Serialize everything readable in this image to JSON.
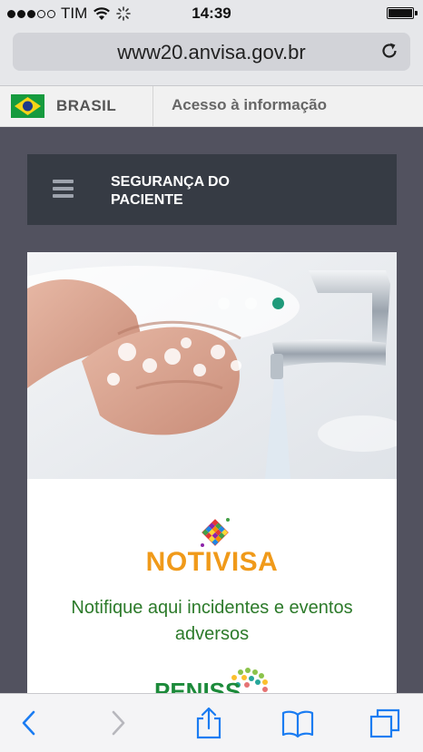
{
  "status": {
    "carrier": "TIM",
    "time": "14:39"
  },
  "browser": {
    "url": "www20.anvisa.gov.br"
  },
  "gov_bar": {
    "country": "BRASIL",
    "link": "Acesso à informação"
  },
  "site": {
    "title_line1": "SEGURANÇA DO",
    "title_line2": "PACIENTE",
    "carousel": {
      "slide_count": 3,
      "active_slide": 3
    },
    "notivisa": {
      "name": "NOTIVISA",
      "description": "Notifique aqui incidentes e eventos adversos"
    },
    "next_brand": "PENISS"
  },
  "colors": {
    "accent_green": "#1f9a7a",
    "notivisa_orange": "#f09a1a",
    "text_green": "#2c7a2a",
    "header_bg": "#363b44"
  },
  "icons": [
    "wifi-icon",
    "activity-spinner-icon",
    "battery-icon",
    "reload-icon",
    "brazil-flag-icon",
    "hamburger-icon",
    "back-icon",
    "forward-icon",
    "share-icon",
    "bookmarks-icon",
    "tabs-icon"
  ]
}
